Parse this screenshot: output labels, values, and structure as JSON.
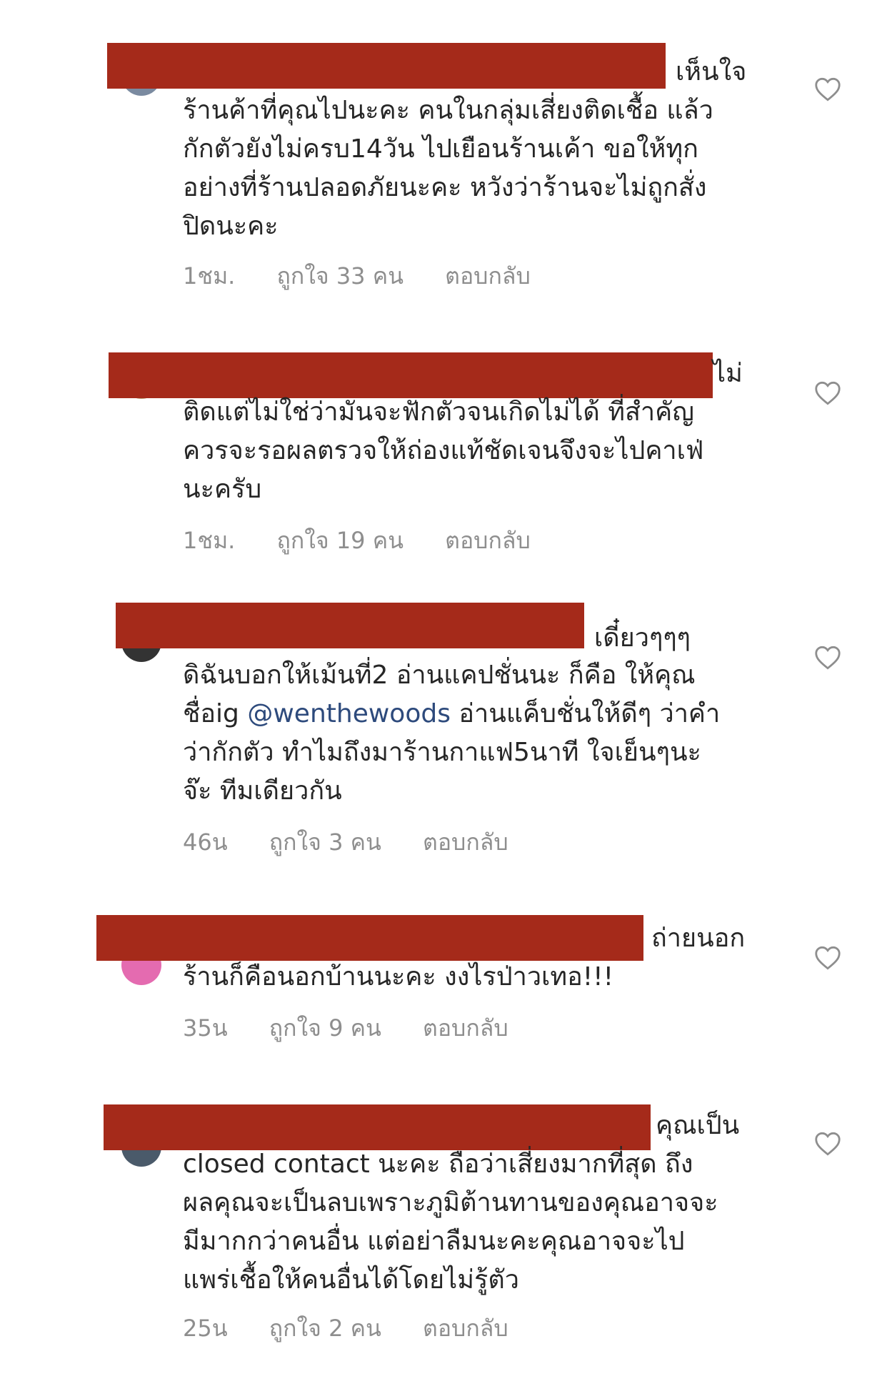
{
  "comments": [
    {
      "tail": "เห็นใจ",
      "lines": [
        "ร้านค้าที่คุณไปนะคะ คนในกลุ่มเสี่ยงติดเชื้อ แล้ว",
        "กักตัวยังไม่ครบ14วัน ไปเยือนร้านเค้า ขอให้ทุก",
        "อย่างที่ร้านปลอดภัยนะคะ หวังว่าร้านจะไม่ถูกสั่ง",
        "ปิดนะคะ"
      ],
      "time": "1ชม.",
      "likes": "ถูกใจ 33 คน",
      "reply": "ตอบกลับ"
    },
    {
      "tail": "ไม่",
      "lines": [
        "ติดแต่ไม่ใช่ว่ามันจะฟักตัวจนเกิดไม่ได้ ที่สำคัญ",
        "ควรจะรอผลตรวจให้ถ่องแท้ชัดเจนจึงจะไปคาเฟ่",
        "นะครับ"
      ],
      "time": "1ชม.",
      "likes": "ถูกใจ 19 คน",
      "reply": "ตอบกลับ"
    },
    {
      "tail": "เดี๋ยวๆๆๆ",
      "lines": [
        "ดิฉันบอกให้เม้นที่2 อ่านแคปชั่นนะ ก็คือ ให้คุณ",
        "ชื่อig ",
        "ว่ากักตัว ทำไมถึงมาร้านกาแฟ5นาที ใจเย็นๆนะ",
        "จ๊ะ ทีมเดียวกัน"
      ],
      "mention": "@wenthewoods",
      "mention_after": " อ่านแค็บชั่นให้ดีๆ ว่าคำ",
      "time": "46น",
      "likes": "ถูกใจ 3 คน",
      "reply": "ตอบกลับ"
    },
    {
      "tail": "ถ่ายนอก",
      "lines": [
        "ร้านก็คือนอกบ้านนะคะ งงไรป่าวเทอ!!!"
      ],
      "time": "35น",
      "likes": "ถูกใจ 9 คน",
      "reply": "ตอบกลับ"
    },
    {
      "tail": "คุณเป็น",
      "lines": [
        "closed contact นะคะ ถือว่าเสี่ยงมากที่สุด ถึง",
        "ผลคุณจะเป็นลบเพราะภูมิต้านทานของคุณอาจจะ",
        "มีมากกว่าคนอื่น แต่อย่าลืมนะคะคุณอาจจะไป",
        "แพร่เชื้อให้คนอื่นได้โดยไม่รู้ตัว"
      ],
      "time": "25น",
      "likes": "ถูกใจ 2 คน",
      "reply": "ตอบกลับ"
    }
  ],
  "colors": {
    "redaction": "#a52a1a",
    "text": "#262626",
    "meta": "#8e8e8e",
    "mention": "#2d4a7c"
  },
  "icons": {
    "like": "heart-outline-icon"
  }
}
